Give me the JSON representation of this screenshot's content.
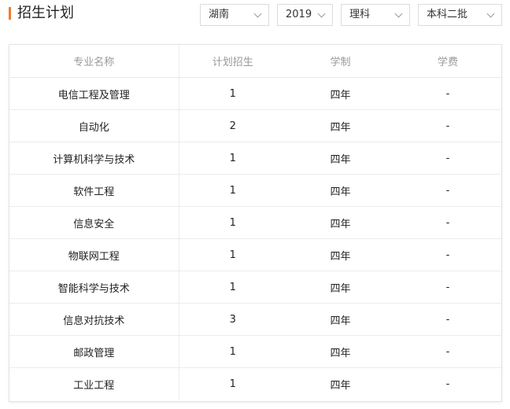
{
  "header": {
    "title": "招生计划",
    "accent_color": "#f07c2b"
  },
  "filters": {
    "province": "湖南",
    "year": "2019",
    "subject": "理科",
    "batch": "本科二批"
  },
  "table": {
    "columns": [
      "专业名称",
      "计划招生",
      "学制",
      "学费"
    ],
    "rows": [
      [
        "电信工程及管理",
        "1",
        "四年",
        "-"
      ],
      [
        "自动化",
        "2",
        "四年",
        "-"
      ],
      [
        "计算机科学与技术",
        "1",
        "四年",
        "-"
      ],
      [
        "软件工程",
        "1",
        "四年",
        "-"
      ],
      [
        "信息安全",
        "1",
        "四年",
        "-"
      ],
      [
        "物联网工程",
        "1",
        "四年",
        "-"
      ],
      [
        "智能科学与技术",
        "1",
        "四年",
        "-"
      ],
      [
        "信息对抗技术",
        "3",
        "四年",
        "-"
      ],
      [
        "邮政管理",
        "1",
        "四年",
        "-"
      ],
      [
        "工业工程",
        "1",
        "四年",
        "-"
      ]
    ]
  }
}
